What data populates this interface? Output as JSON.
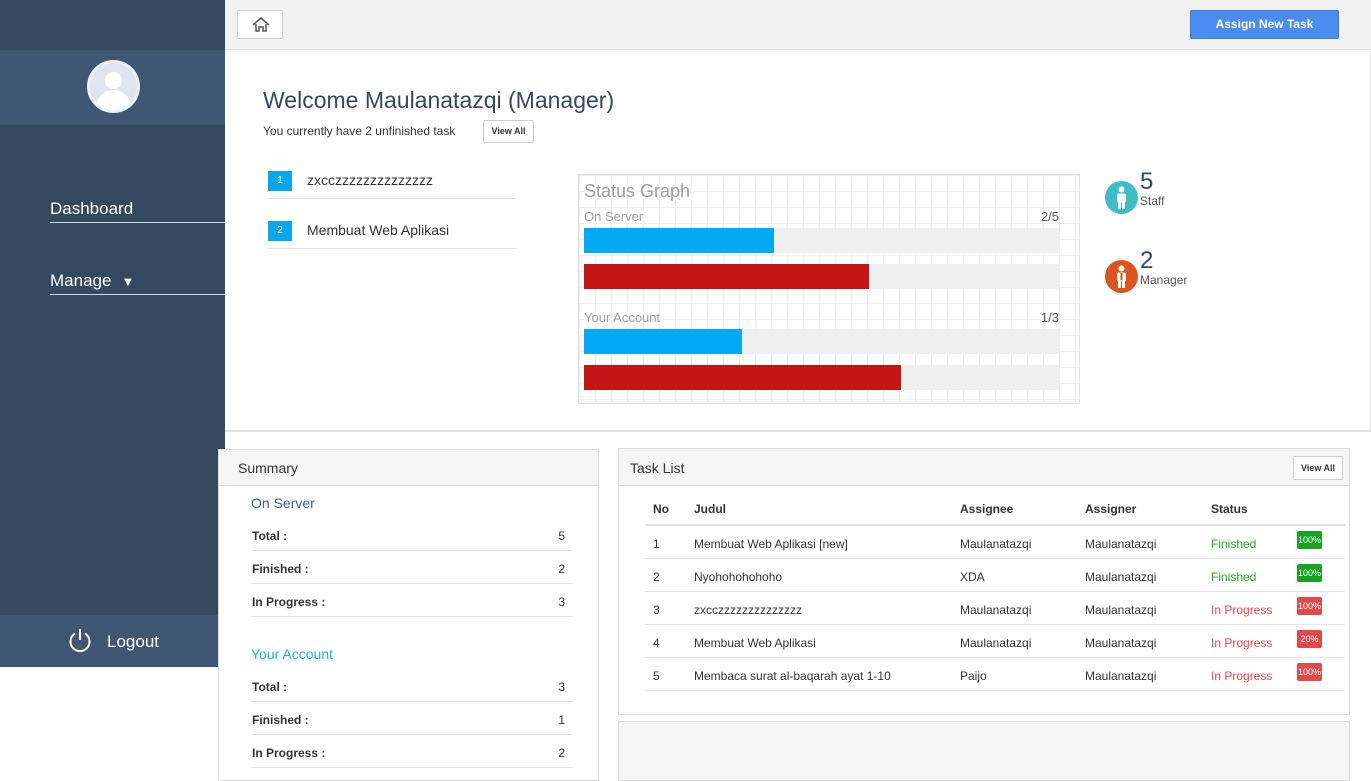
{
  "topbar": {
    "assign_label": "Assign New Task"
  },
  "sidebar": {
    "nav": [
      {
        "label": "Dashboard"
      },
      {
        "label": "Manage"
      }
    ],
    "logout_label": "Logout"
  },
  "welcome": {
    "title": "Welcome Maulanatazqi (Manager)",
    "subtitle": "You currently have 2 unfinished task",
    "view_all": "View All",
    "tasks": [
      {
        "num": "1",
        "title": "zxcczzzzzzzzzzzzzz"
      },
      {
        "num": "2",
        "title": "Membuat Web Aplikasi"
      }
    ]
  },
  "graph": {
    "title": "Status Graph",
    "groups": [
      {
        "label": "On Server",
        "count": "2/5",
        "blue_fraction": 0.4,
        "red_fraction": 0.6
      },
      {
        "label": "Your Account",
        "count": "1/3",
        "blue_fraction": 0.333,
        "red_fraction": 0.667
      }
    ],
    "colors": {
      "blue": "#03a9f4",
      "red": "#c41414"
    }
  },
  "stats": [
    {
      "number": "5",
      "label": "Staff",
      "color": "#3fbcc6",
      "icon": "staff-icon"
    },
    {
      "number": "2",
      "label": "Manager",
      "color": "#d9541e",
      "icon": "manager-icon"
    }
  ],
  "summary": {
    "title": "Summary",
    "sections": [
      {
        "title": "On Server",
        "color": "#3b5fa8",
        "rows": [
          {
            "k": "Total :",
            "v": "5"
          },
          {
            "k": "Finished :",
            "v": "2"
          },
          {
            "k": "In Progress :",
            "v": "3"
          }
        ]
      },
      {
        "title": "Your Account",
        "color": "#1fb4cf",
        "rows": [
          {
            "k": "Total :",
            "v": "3"
          },
          {
            "k": "Finished :",
            "v": "1"
          },
          {
            "k": "In Progress :",
            "v": "2"
          }
        ]
      }
    ]
  },
  "tasklist": {
    "title": "Task List",
    "view_all": "View All",
    "columns": [
      "No",
      "Judul",
      "Assignee",
      "Assigner",
      "Status"
    ],
    "rows": [
      {
        "no": "1",
        "judul": "Membuat Web Aplikasi [new]",
        "assignee": "Maulanatazqi",
        "assigner": "Maulanatazqi",
        "status": "Finished",
        "badge": "100%"
      },
      {
        "no": "2",
        "judul": "Nyohohohohoho",
        "assignee": "XDA",
        "assigner": "Maulanatazqi",
        "status": "Finished",
        "badge": "100%"
      },
      {
        "no": "3",
        "judul": "zxcczzzzzzzzzzzzzz",
        "assignee": "Maulanatazqi",
        "assigner": "Maulanatazqi",
        "status": "In Progress",
        "badge": "100%"
      },
      {
        "no": "4",
        "judul": "Membuat Web Aplikasi",
        "assignee": "Maulanatazqi",
        "assigner": "Maulanatazqi",
        "status": "In Progress",
        "badge": "20%"
      },
      {
        "no": "5",
        "judul": "Membaca surat al-baqarah ayat 1-10",
        "assignee": "Paijo",
        "assigner": "Maulanatazqi",
        "status": "In Progress",
        "badge": "100%"
      }
    ]
  }
}
